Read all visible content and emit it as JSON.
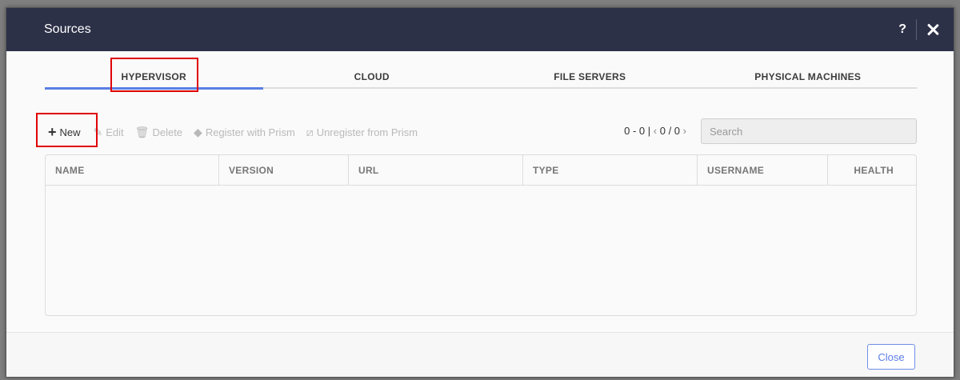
{
  "dialog": {
    "title": "Sources",
    "help_label": "?"
  },
  "tabs": [
    {
      "label": "HYPERVISOR",
      "active": true
    },
    {
      "label": "CLOUD",
      "active": false
    },
    {
      "label": "FILE SERVERS",
      "active": false
    },
    {
      "label": "PHYSICAL MACHINES",
      "active": false
    }
  ],
  "toolbar": {
    "new_label": "New",
    "edit_label": "Edit",
    "delete_label": "Delete",
    "register_label": "Register with Prism",
    "unregister_label": "Unregister from Prism"
  },
  "pager": {
    "range": "0 - 0",
    "pages": "0 / 0"
  },
  "search": {
    "placeholder": "Search"
  },
  "table": {
    "columns": [
      "NAME",
      "VERSION",
      "URL",
      "TYPE",
      "USERNAME",
      "HEALTH"
    ],
    "rows": []
  },
  "footer": {
    "close_label": "Close"
  },
  "colors": {
    "header_bg": "#2d3148",
    "accent": "#5b7ee5",
    "highlight": "#e00000"
  }
}
